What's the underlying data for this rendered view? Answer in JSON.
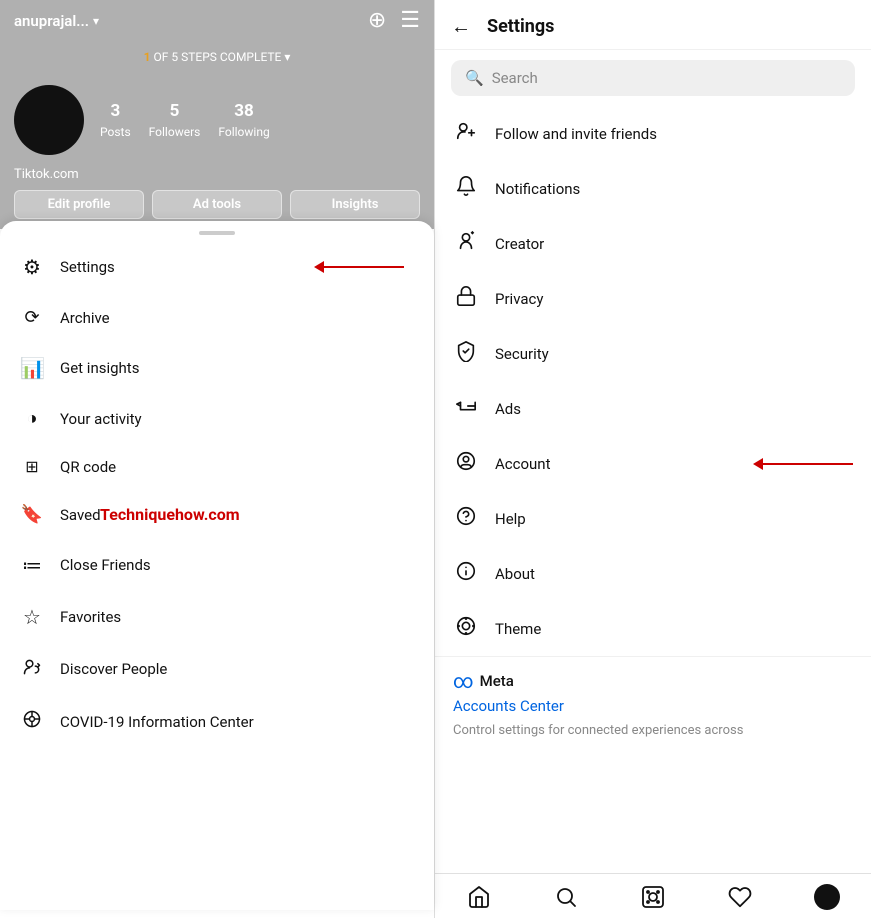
{
  "left": {
    "username": "anuprajal...",
    "steps": {
      "current": "1",
      "total": "5",
      "label": "OF",
      "suffix": "STEPS COMPLETE"
    },
    "stats": [
      {
        "number": "3",
        "label": "Posts"
      },
      {
        "number": "5",
        "label": "Followers"
      },
      {
        "number": "38",
        "label": "Following"
      }
    ],
    "profile_link": "Tiktok.com",
    "actions": [
      {
        "label": "Edit profile"
      },
      {
        "label": "Ad tools"
      },
      {
        "label": "Insights"
      }
    ],
    "menu_items": [
      {
        "icon": "⚙",
        "label": "Settings",
        "has_arrow": true
      },
      {
        "icon": "↺",
        "label": "Archive"
      },
      {
        "icon": "📊",
        "label": "Get insights"
      },
      {
        "icon": "◑",
        "label": "Your activity"
      },
      {
        "icon": "⊞",
        "label": "QR code"
      },
      {
        "icon": "🔖",
        "label": "Saved"
      },
      {
        "icon": "≔",
        "label": "Close Friends"
      },
      {
        "icon": "☆",
        "label": "Favorites"
      },
      {
        "icon": "👤+",
        "label": "Discover People"
      },
      {
        "icon": "ℹ",
        "label": "COVID-19 Information Center"
      }
    ],
    "watermark": "Techniquehow.com"
  },
  "right": {
    "title": "Settings",
    "search_placeholder": "Search",
    "settings_items": [
      {
        "icon": "👤+",
        "label": "Follow and invite friends"
      },
      {
        "icon": "🔔",
        "label": "Notifications"
      },
      {
        "icon": "✦",
        "label": "Creator"
      },
      {
        "icon": "🔒",
        "label": "Privacy"
      },
      {
        "icon": "🛡",
        "label": "Security"
      },
      {
        "icon": "📢",
        "label": "Ads"
      },
      {
        "icon": "👤",
        "label": "Account",
        "has_arrow": true
      },
      {
        "icon": "⊙",
        "label": "Help"
      },
      {
        "icon": "ℹ",
        "label": "About"
      },
      {
        "icon": "◎",
        "label": "Theme"
      }
    ],
    "meta": {
      "logo": "∞",
      "brand": "Meta",
      "link": "Accounts Center",
      "desc": "Control settings for connected experiences across"
    },
    "bottom_nav": [
      {
        "icon": "⌂",
        "label": "home"
      },
      {
        "icon": "🔍",
        "label": "search"
      },
      {
        "icon": "▷",
        "label": "reels"
      },
      {
        "icon": "♡",
        "label": "likes"
      },
      {
        "icon": "avatar",
        "label": "profile"
      }
    ]
  }
}
